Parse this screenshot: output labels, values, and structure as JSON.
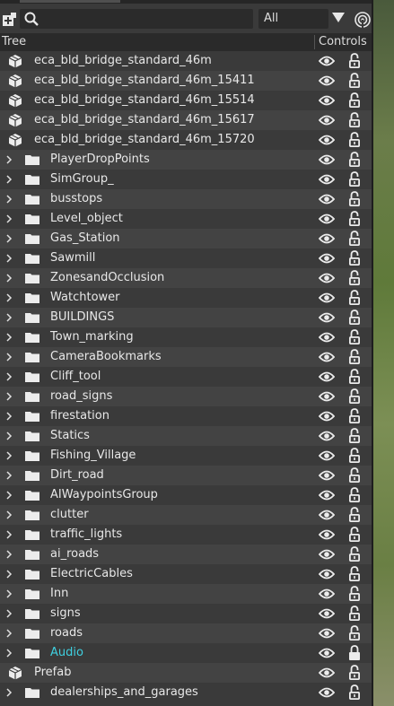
{
  "toolbar": {
    "search_value": "",
    "filter_value": "All"
  },
  "header": {
    "tree_label": "Tree",
    "controls_label": "Controls"
  },
  "rows": [
    {
      "label": "eca_bld_bridge_standard_46m",
      "kind": "object",
      "locked": false
    },
    {
      "label": "eca_bld_bridge_standard_46m_15411",
      "kind": "object",
      "locked": false
    },
    {
      "label": "eca_bld_bridge_standard_46m_15514",
      "kind": "object",
      "locked": false
    },
    {
      "label": "eca_bld_bridge_standard_46m_15617",
      "kind": "object",
      "locked": false
    },
    {
      "label": "eca_bld_bridge_standard_46m_15720",
      "kind": "object",
      "locked": false
    },
    {
      "label": "PlayerDropPoints",
      "kind": "folder",
      "locked": false
    },
    {
      "label": "SimGroup_",
      "kind": "folder",
      "locked": false
    },
    {
      "label": "busstops",
      "kind": "folder",
      "locked": false
    },
    {
      "label": "Level_object",
      "kind": "folder",
      "locked": false
    },
    {
      "label": "Gas_Station",
      "kind": "folder",
      "locked": false
    },
    {
      "label": "Sawmill",
      "kind": "folder",
      "locked": false
    },
    {
      "label": "ZonesandOcclusion",
      "kind": "folder",
      "locked": false
    },
    {
      "label": "Watchtower",
      "kind": "folder",
      "locked": false
    },
    {
      "label": "BUILDINGS",
      "kind": "folder",
      "locked": false
    },
    {
      "label": "Town_marking",
      "kind": "folder",
      "locked": false
    },
    {
      "label": "CameraBookmarks",
      "kind": "folder",
      "locked": false
    },
    {
      "label": "Cliff_tool",
      "kind": "folder",
      "locked": false
    },
    {
      "label": "road_signs",
      "kind": "folder",
      "locked": false
    },
    {
      "label": "firestation",
      "kind": "folder",
      "locked": false
    },
    {
      "label": "Statics",
      "kind": "folder",
      "locked": false
    },
    {
      "label": "Fishing_Village",
      "kind": "folder",
      "locked": false
    },
    {
      "label": "Dirt_road",
      "kind": "folder",
      "locked": false
    },
    {
      "label": "AIWaypointsGroup",
      "kind": "folder",
      "locked": false
    },
    {
      "label": "clutter",
      "kind": "folder",
      "locked": false
    },
    {
      "label": "traffic_lights",
      "kind": "folder",
      "locked": false
    },
    {
      "label": "ai_roads",
      "kind": "folder",
      "locked": false
    },
    {
      "label": "ElectricCables",
      "kind": "folder",
      "locked": false
    },
    {
      "label": "Inn",
      "kind": "folder",
      "locked": false
    },
    {
      "label": "signs",
      "kind": "folder",
      "locked": false
    },
    {
      "label": "roads",
      "kind": "folder",
      "locked": false
    },
    {
      "label": "Audio",
      "kind": "folder",
      "locked": true,
      "highlight": true
    },
    {
      "label": "Prefab",
      "kind": "object",
      "locked": false
    },
    {
      "label": "dealerships_and_garages",
      "kind": "folder",
      "locked": false
    }
  ],
  "colors": {
    "highlight_text": "#3fd0e0",
    "panel_bg": "#3a3a3a",
    "alt_row_bg": "#434343"
  }
}
